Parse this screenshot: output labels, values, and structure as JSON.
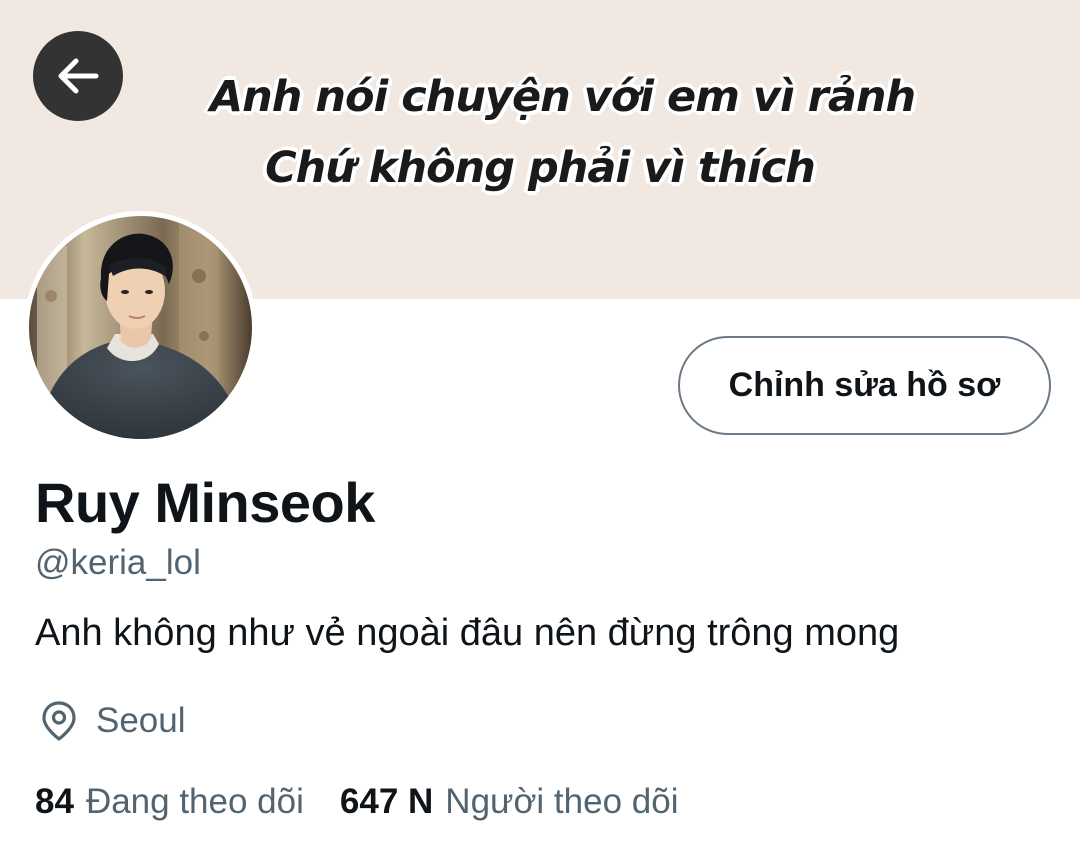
{
  "banner": {
    "line1": "Anh nói chuyện với em vì rảnh",
    "line2": "Chứ không phải vì thích",
    "background_color": "#f1e9e1"
  },
  "nav": {
    "back_icon": "arrow-left-icon"
  },
  "profile": {
    "edit_button_label": "Chỉnh sửa hồ sơ",
    "display_name": "Ruy Minseok",
    "handle": "@keria_lol",
    "bio": "Anh không như vẻ ngoài đâu nên đừng trông mong",
    "location_icon": "map-pin-icon",
    "location": "Seoul"
  },
  "stats": {
    "following_count": "84",
    "following_label": "Đang theo dõi",
    "followers_count": "647 N",
    "followers_label": "Người theo dõi"
  },
  "colors": {
    "text_primary": "#0f1419",
    "text_secondary": "#536471",
    "back_button_bg": "#333333"
  }
}
